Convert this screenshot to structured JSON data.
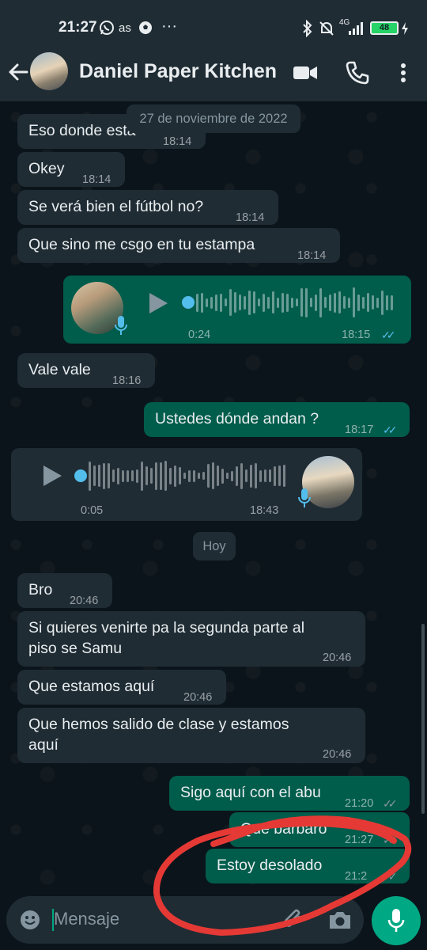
{
  "status_bar": {
    "time": "21:27",
    "carrier_text": "as",
    "more": "···",
    "network": "4G",
    "battery": "48",
    "icons": [
      "whatsapp-icon",
      "soccer-icon",
      "bluetooth-icon",
      "mute-icon",
      "signal-icon",
      "battery-icon",
      "charging-icon"
    ]
  },
  "header": {
    "title": "Daniel Paper Kitchen",
    "icons": [
      "back-arrow-icon",
      "avatar",
      "video-call-icon",
      "phone-icon",
      "more-vert-icon"
    ]
  },
  "chat": {
    "date_chip": "27 de noviembre de 2022",
    "today_chip": "Hoy",
    "messages": [
      {
        "text": "Eso donde esta",
        "time": "18:14"
      },
      {
        "text": "Okey",
        "time": "18:14"
      },
      {
        "text": "Se verá bien el fútbol no?",
        "time": "18:14"
      },
      {
        "text": "Que sino me csgo en tu estampa",
        "time": "18:14"
      },
      {
        "duration": "0:24",
        "time": "18:15"
      },
      {
        "text": "Vale vale",
        "time": "18:16"
      },
      {
        "text": "Ustedes dónde andan ?",
        "time": "18:17"
      },
      {
        "duration": "0:05",
        "time": "18:43"
      },
      {
        "text": "Bro",
        "time": "20:46"
      },
      {
        "text_line1": "Si quieres venirte pa la segunda parte al",
        "text_line2": "piso se Samu",
        "time": "20:46"
      },
      {
        "text": "Que estamos aquí",
        "time": "20:46"
      },
      {
        "text_line1": "Que hemos salido de clase y estamos",
        "text_line2": "aquí",
        "time": "20:46"
      },
      {
        "text": "Sigo aquí con el abu",
        "time": "21:20"
      },
      {
        "text": "Que bárbaro",
        "time": "21:27"
      },
      {
        "text": "Estoy desolado",
        "time": "21:2"
      }
    ]
  },
  "input": {
    "placeholder": "Mensaje",
    "icons": [
      "emoji-icon",
      "attach-icon",
      "camera-icon",
      "mic-icon"
    ]
  },
  "colors": {
    "background": "#0b141a",
    "incoming": "#1f2c34",
    "outgoing": "#005c4b",
    "accent": "#00a884",
    "read_ticks": "#53bdeb",
    "annotation": "#e53935"
  }
}
